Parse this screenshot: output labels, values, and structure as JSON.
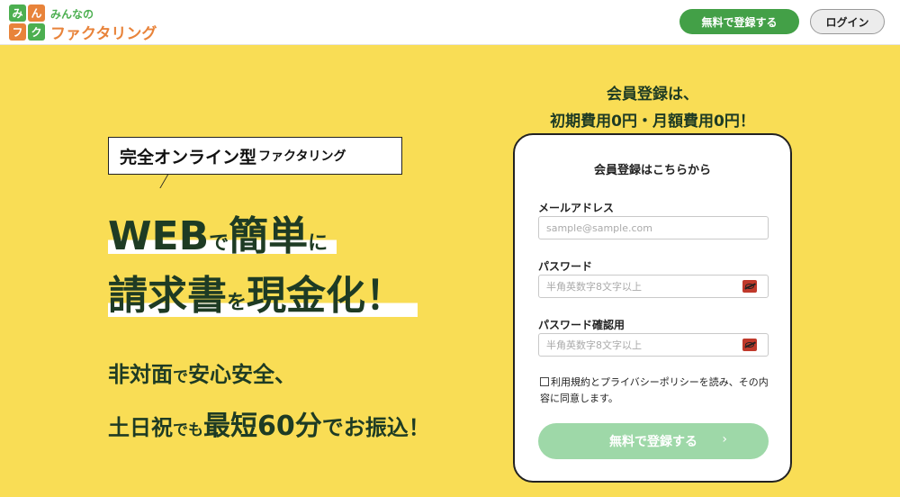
{
  "header": {
    "logo_tiles": [
      "み",
      "ん",
      "フ",
      "ク"
    ],
    "logo_top": "みんなの",
    "logo_bottom": "ファクタリング",
    "register_label": "無料で登録する",
    "login_label": "ログイン"
  },
  "hero": {
    "tag_main": "完全オンライン型",
    "tag_sub": "ファクタリング",
    "line1": [
      "WEB",
      "で",
      "簡単",
      "に"
    ],
    "line2": [
      "請求書",
      "を",
      "現金化！"
    ],
    "sub1": [
      "非対面",
      "で",
      "安心安全、"
    ],
    "sub2": [
      "土日祝",
      "でも",
      "最短60分",
      "でお振込！"
    ]
  },
  "promo": {
    "line1": "会員登録は、",
    "line2": "初期費用0円・月額費用0円！"
  },
  "form": {
    "title": "会員登録はこちらから",
    "email_label": "メールアドレス",
    "email_placeholder": "sample@sample.com",
    "password_label": "パスワード",
    "password_placeholder": "半角英数字8文字以上",
    "confirm_label": "パスワード確認用",
    "confirm_placeholder": "半角英数字8文字以上",
    "agree_text": "利用規約とプライバシーポリシーを読み、その内容に同意します。",
    "submit_label": "無料で登録する",
    "submit_chevron": "›"
  },
  "colors": {
    "background": "#f9dd55",
    "brand_green": "#43a047",
    "brand_orange": "#e8833a",
    "heading_text": "#1e3b24",
    "submit_disabled": "#9ed8a8"
  },
  "icons": [
    "eye-off-icon",
    "chevron-right-icon",
    "checkbox-icon"
  ]
}
